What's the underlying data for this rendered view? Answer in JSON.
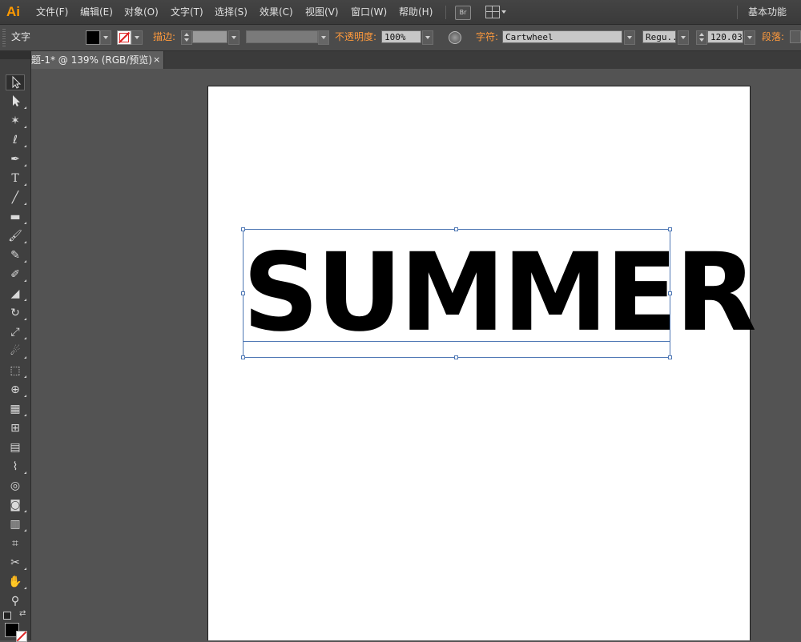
{
  "app": {
    "logo": "Ai"
  },
  "menu": {
    "items": [
      {
        "id": "file",
        "label": "文件(F)"
      },
      {
        "id": "edit",
        "label": "编辑(E)"
      },
      {
        "id": "object",
        "label": "对象(O)"
      },
      {
        "id": "type",
        "label": "文字(T)"
      },
      {
        "id": "select",
        "label": "选择(S)"
      },
      {
        "id": "effect",
        "label": "效果(C)"
      },
      {
        "id": "view",
        "label": "视图(V)"
      },
      {
        "id": "window",
        "label": "窗口(W)"
      },
      {
        "id": "help",
        "label": "帮助(H)"
      }
    ],
    "bridge_label": "Br",
    "workspace_label": "基本功能"
  },
  "control": {
    "tool_label": "文字",
    "stroke_label": "描边:",
    "opacity_label": "不透明度:",
    "opacity_value": "100%",
    "character_label": "字符:",
    "font_family": "Cartwheel",
    "font_style": "Regu...",
    "font_size": "120.03",
    "paragraph_label": "段落:",
    "fill_color": "#000000",
    "stroke_color": "none"
  },
  "document": {
    "tab_label": "题-1* @ 139% (RGB/预览)",
    "close_label": "×"
  },
  "artwork": {
    "text": "SUMMER"
  },
  "toolbar": {
    "tools": [
      "selection-tool-icon",
      "direct-selection-tool-icon",
      "magic-wand-tool-icon",
      "lasso-tool-icon",
      "pen-tool-icon",
      "type-tool-icon",
      "line-segment-tool-icon",
      "rectangle-tool-icon",
      "paintbrush-tool-icon",
      "pencil-tool-icon",
      "blob-brush-tool-icon",
      "eraser-tool-icon",
      "rotate-tool-icon",
      "scale-tool-icon",
      "warp-tool-icon",
      "free-transform-tool-icon",
      "shape-builder-tool-icon",
      "perspective-grid-tool-icon",
      "mesh-tool-icon",
      "gradient-tool-icon",
      "eyedropper-tool-icon",
      "blend-tool-icon",
      "symbol-sprayer-tool-icon",
      "column-graph-tool-icon",
      "artboard-tool-icon",
      "slice-tool-icon",
      "hand-tool-icon",
      "zoom-tool-icon"
    ]
  }
}
